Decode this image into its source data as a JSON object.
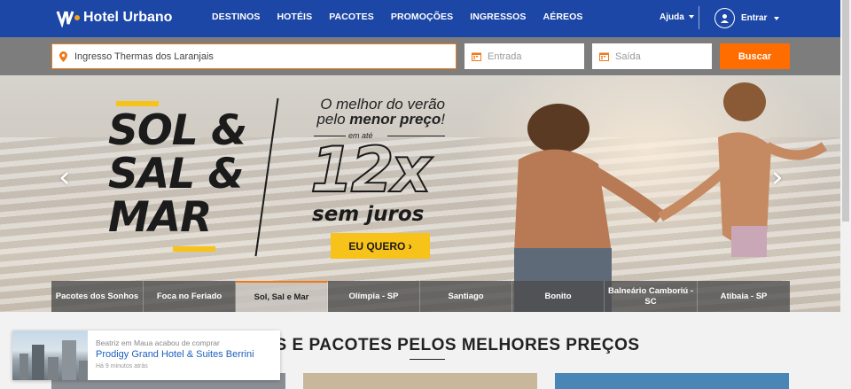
{
  "brand": {
    "name": "Hotel Urbano"
  },
  "nav": {
    "items": [
      "DESTINOS",
      "HOTÉIS",
      "PACOTES",
      "PROMOÇÕES",
      "INGRESSOS",
      "AÉREOS"
    ],
    "help": "Ajuda",
    "login": "Entrar"
  },
  "search": {
    "destination_value": "Ingresso Thermas dos Laranjais",
    "checkin_placeholder": "Entrada",
    "checkout_placeholder": "Saída",
    "button": "Buscar"
  },
  "hero": {
    "headline": [
      "SOL &",
      "SAL &",
      "MAR"
    ],
    "promo_line1": "O melhor do verão",
    "promo_line2_a": "pelo ",
    "promo_line2_b": "menor preço",
    "promo_line2_c": "!",
    "em_ate": "em até",
    "installments": "12x",
    "no_interest": "sem juros",
    "cta": "EU QUERO ›"
  },
  "carousel_tabs": [
    "Pacotes dos Sonhos",
    "Foca no Feriado",
    "Sol, Sal e Mar",
    "Olímpia - SP",
    "Santiago",
    "Bonito",
    "Balneário Camboriú - SC",
    "Atibaia - SP"
  ],
  "active_tab": "Sol, Sal e Mar",
  "section": {
    "title": "HOTÉIS E PACOTES PELOS MELHORES PREÇOS"
  },
  "toast": {
    "line1": "Beatriz em Maua acabou de comprar",
    "hotel": "Prodigy Grand Hotel & Suites Berrini",
    "time": "Há 9 minutos atrás"
  },
  "colors": {
    "topbar": "#1d47a6",
    "accent": "#ff6c00",
    "yellow": "#f7c21a"
  }
}
